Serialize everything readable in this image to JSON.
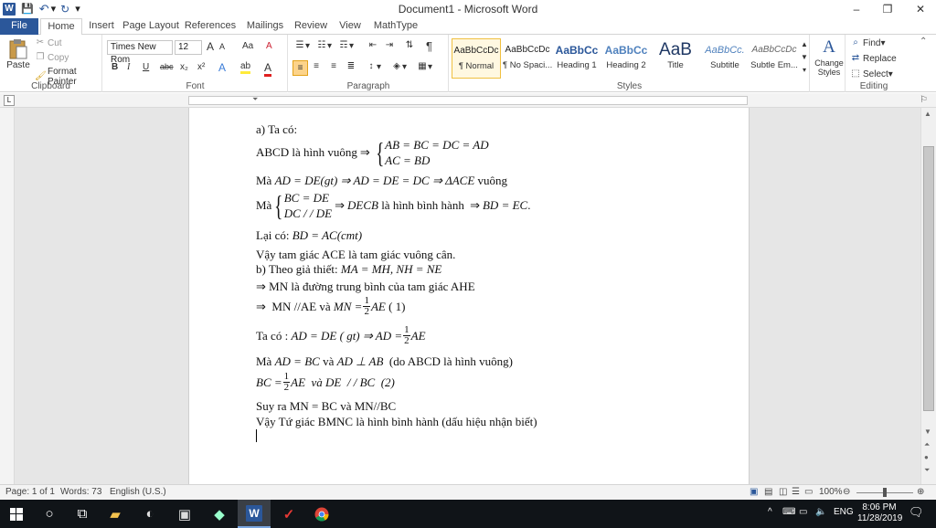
{
  "window": {
    "title": "Document1 - Microsoft Word",
    "minimize": "–",
    "restore": "❐",
    "close": "✕"
  },
  "quick_access": {
    "save": "💾",
    "undo": "↶",
    "redo": "↻",
    "customize": "▾"
  },
  "tabs": [
    "File",
    "Home",
    "Insert",
    "Page Layout",
    "References",
    "Mailings",
    "Review",
    "View",
    "MathType"
  ],
  "ribbon": {
    "clipboard": {
      "label": "Clipboard",
      "paste": "Paste",
      "cut": "Cut",
      "copy": "Copy",
      "format_painter": "Format Painter"
    },
    "font": {
      "label": "Font",
      "family": "Times New Rom",
      "size": "12",
      "grow": "A",
      "shrink": "A",
      "change_case": "Aa",
      "clear": "A",
      "bold": "B",
      "italic": "I",
      "underline": "U",
      "strike": "abc",
      "subscript": "x₂",
      "superscript": "x²",
      "text_effects": "A",
      "highlight": "ab",
      "font_color": "A"
    },
    "paragraph": {
      "label": "Paragraph",
      "pilcrow": "¶"
    },
    "styles": {
      "label": "Styles",
      "items": [
        {
          "preview": "AaBbCcDc",
          "name": "¶ Normal"
        },
        {
          "preview": "AaBbCcDc",
          "name": "¶ No Spaci..."
        },
        {
          "preview": "AaBbCc",
          "name": "Heading 1"
        },
        {
          "preview": "AaBbCc",
          "name": "Heading 2"
        },
        {
          "preview": "AaB",
          "name": "Title"
        },
        {
          "preview": "AaBbCc.",
          "name": "Subtitle"
        },
        {
          "preview": "AaBbCcDc",
          "name": "Subtle Em..."
        }
      ],
      "change_styles": "Change Styles"
    },
    "editing": {
      "label": "Editing",
      "find": "Find",
      "replace": "Replace",
      "select": "Select"
    }
  },
  "document": {
    "l1": "a) Ta có:",
    "l2_text": "ABCD là hình vuông ",
    "l2_sys1": "AB = BC = DC = AD",
    "l2_sys2": "AC = BD",
    "l3_text": "Mà ",
    "l3_math": "AD = DE(gt) ⇒ AD = DE = DC ⇒ ΔACE",
    "l3_tail": " vuông",
    "l4_text": "Mà ",
    "l4_sys1": "BC = DE",
    "l4_sys2": "DC / / DE",
    "l4_math1": "DECB",
    "l4_mid": " là hình bình hành ",
    "l4_math2": "BD = EC",
    "l4_end": " .",
    "l5_text": "Lại có: ",
    "l5_math": "BD = AC(cmt)",
    "l6": "Vậy tam giác ACE là tam giác vuông cân.",
    "l7_text": "b) Theo giả thiết: ",
    "l7_math": "MA = MH, NH = NE",
    "l8": "⇒ MN là đường trung bình của tam giác AHE",
    "l9_a": "⇒  MN //AE và ",
    "l9_m": "MN =",
    "l9_num": "1",
    "l9_den": "2",
    "l9_tail": "AE",
    "l9_ref": " ( 1)",
    "l10_a": "Ta có : ",
    "l10_m": "AD = DE ( gt) ⇒ AD =",
    "l10_num": "1",
    "l10_den": "2",
    "l10_tail": "AE",
    "l11_a": "Mà ",
    "l11_m1": "AD = BC",
    "l11_b": " và ",
    "l11_m2": "AD ⊥ AB",
    "l11_c": "  (do ABCD là hình vuông)",
    "l12_m": "BC =",
    "l12_num": "1",
    "l12_den": "2",
    "l12_tail": "AE  và DE  / / BC  (2)",
    "l13": "Suy ra MN = BC và MN//BC",
    "l14": "Vậy Tứ giác BMNC là hình bình hành (dấu hiệu nhận biết)"
  },
  "statusbar": {
    "page": "Page: 1 of 1",
    "words": "Words: 73",
    "language": "English (U.S.)",
    "zoom": "100%"
  },
  "taskbar": {
    "language": "ENG",
    "time": "8:06 PM",
    "date": "11/28/2019"
  }
}
